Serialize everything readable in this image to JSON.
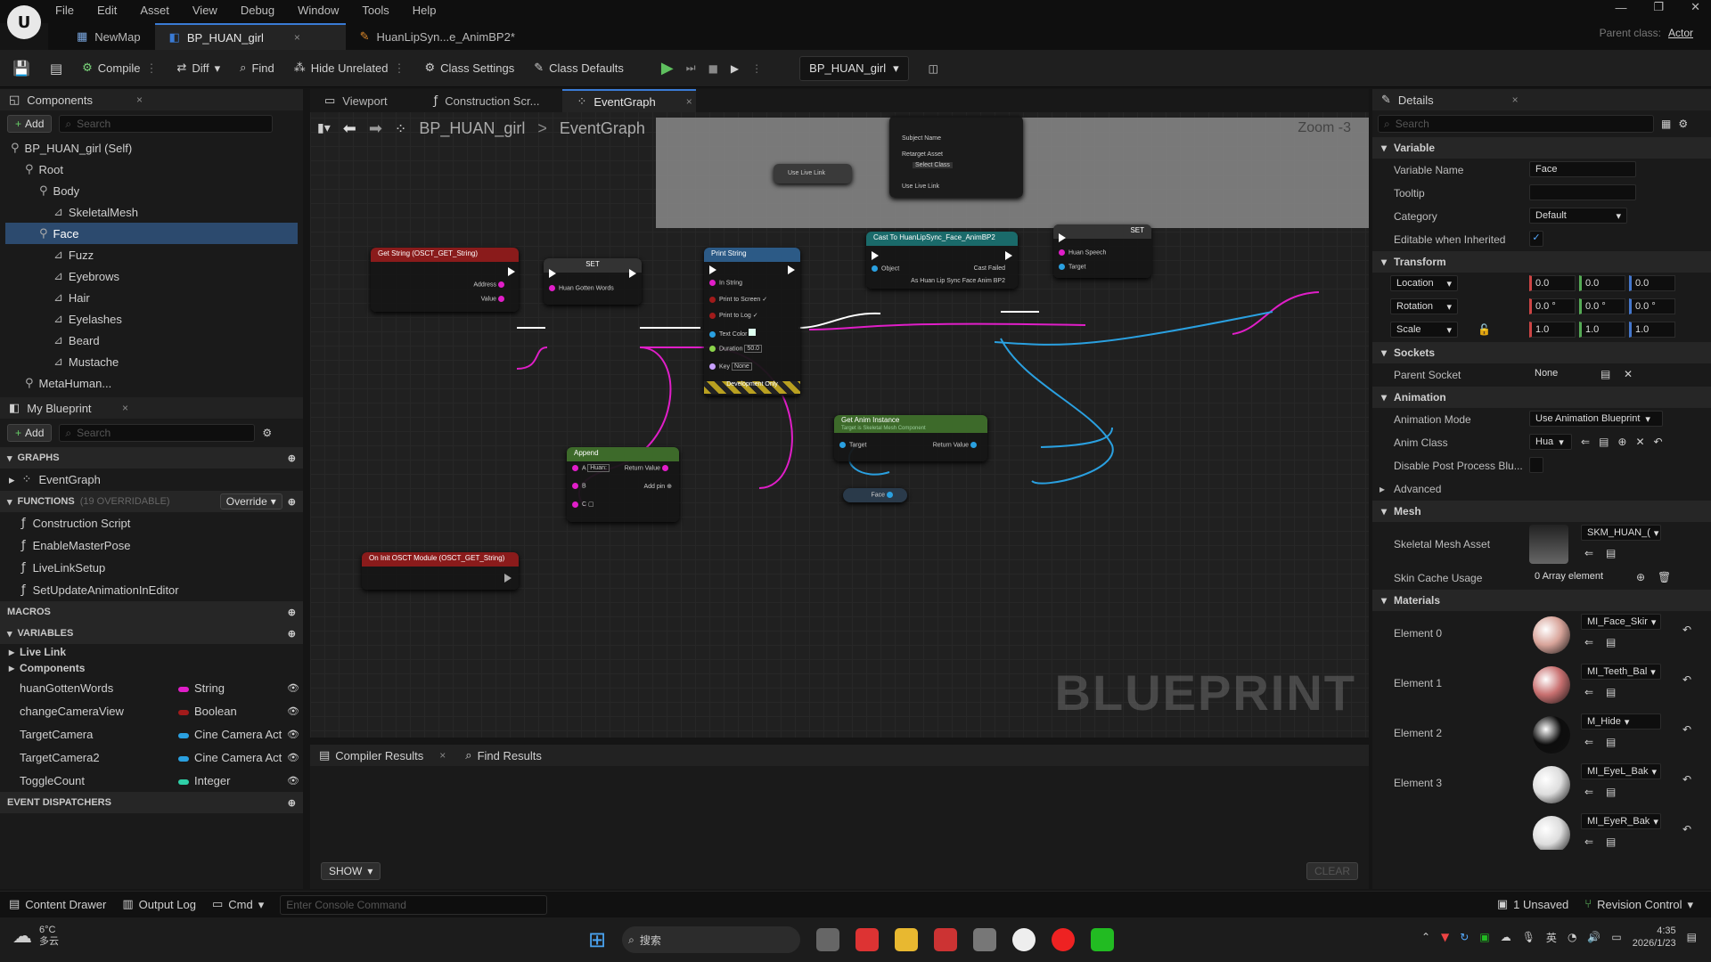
{
  "menu": [
    "File",
    "Edit",
    "Asset",
    "View",
    "Debug",
    "Window",
    "Tools",
    "Help"
  ],
  "doc_tabs": [
    {
      "label": "NewMap",
      "close": ""
    },
    {
      "label": "BP_HUAN_girl",
      "close": "×"
    },
    {
      "label": "HuanLipSyn...e_AnimBP2*",
      "close": ""
    }
  ],
  "parent_class": {
    "label": "Parent class:",
    "value": "Actor"
  },
  "toolbar": {
    "compile": "Compile",
    "diff": "Diff",
    "find": "Find",
    "hide_unrelated": "Hide Unrelated",
    "class_settings": "Class Settings",
    "class_defaults": "Class Defaults",
    "debug_target": "BP_HUAN_girl"
  },
  "components": {
    "title": "Components",
    "add": "Add",
    "search_placeholder": "Search",
    "tree": [
      {
        "label": "BP_HUAN_girl (Self)",
        "depth": 0
      },
      {
        "label": "Root",
        "depth": 1
      },
      {
        "label": "Body",
        "depth": 2
      },
      {
        "label": "SkeletalMesh",
        "depth": 3
      },
      {
        "label": "Face",
        "depth": 2,
        "selected": true
      },
      {
        "label": "Fuzz",
        "depth": 3
      },
      {
        "label": "Eyebrows",
        "depth": 3
      },
      {
        "label": "Hair",
        "depth": 3
      },
      {
        "label": "Eyelashes",
        "depth": 3
      },
      {
        "label": "Beard",
        "depth": 3
      },
      {
        "label": "Mustache",
        "depth": 3
      },
      {
        "label": "MetaHuman...",
        "depth": 1
      }
    ]
  },
  "my_blueprint": {
    "title": "My Blueprint",
    "add": "Add",
    "search_placeholder": "Search",
    "graphs_label": "GRAPHS",
    "event_graph": "EventGraph",
    "functions_label": "FUNCTIONS",
    "functions_count": "(19 OVERRIDABLE)",
    "override": "Override",
    "functions": [
      "Construction Script",
      "EnableMasterPose",
      "LiveLinkSetup",
      "SetUpdateAnimationInEditor"
    ],
    "macros_label": "MACROS",
    "variables_label": "VARIABLES",
    "live_link": "Live Link",
    "components_label": "Components",
    "variables": [
      {
        "name": "huanGottenWords",
        "type": "String",
        "color": "#e01ec8"
      },
      {
        "name": "changeCameraView",
        "type": "Boolean",
        "color": "#a11b1b"
      },
      {
        "name": "TargetCamera",
        "type": "Cine Camera Act",
        "color": "#2aa0e0"
      },
      {
        "name": "TargetCamera2",
        "type": "Cine Camera Act",
        "color": "#2aa0e0"
      },
      {
        "name": "ToggleCount",
        "type": "Integer",
        "color": "#2fd0a8"
      }
    ],
    "dispatchers_label": "EVENT DISPATCHERS"
  },
  "graph_tabs": [
    {
      "label": "Viewport"
    },
    {
      "label": "Construction Scr..."
    },
    {
      "label": "EventGraph",
      "close": "×"
    }
  ],
  "breadcrumb": {
    "bp": "BP_HUAN_girl",
    "sep": ">",
    "graph": "EventGraph",
    "zoom": "Zoom -3"
  },
  "nodes": {
    "use_live_link": "Use Live Link",
    "subject_name": "Subject Name",
    "retarget_asset": "Retarget Asset",
    "select_class": "Select Class",
    "use_live_link2": "Use Live Link",
    "get_string": "Get String (OSCT_GET_String)",
    "address": "Address",
    "value": "Value",
    "set": "SET",
    "huan_gotten_words": "Huan Gotten Words",
    "print_string": "Print String",
    "in_string": "In String",
    "print_to_screen": "Print to Screen",
    "print_to_log": "Print to Log",
    "text_color": "Text Color",
    "duration": "Duration",
    "duration_val": "50.0",
    "key": "Key",
    "key_val": "None",
    "dev_only": "Development Only",
    "cast": "Cast To HuanLipSync_Face_AnimBP2",
    "object": "Object",
    "cast_failed": "Cast Failed",
    "as_huan": "As Huan Lip Sync Face Anim BP2",
    "set2": "SET",
    "huan_speech": "Huan Speech",
    "target": "Target",
    "append": "Append",
    "a": "A",
    "a_val": "Huan:",
    "b": "B",
    "c": "C",
    "return_value": "Return Value",
    "add_pin": "Add pin",
    "get_anim": "Get Anim Instance",
    "get_anim_sub": "Target is Skeletal Mesh Component",
    "target2": "Target",
    "return_value2": "Return Value",
    "face": "Face",
    "on_init": "On Init OSCT Module (OSCT_GET_String)"
  },
  "watermark": "BLUEPRINT",
  "results_tabs": {
    "compiler": "Compiler Results",
    "find": "Find Results",
    "show": "SHOW",
    "clear": "CLEAR"
  },
  "details": {
    "title": "Details",
    "search_placeholder": "Search",
    "variable": {
      "section": "Variable",
      "name_label": "Variable Name",
      "name_val": "Face",
      "tooltip_label": "Tooltip",
      "category_label": "Category",
      "category_val": "Default",
      "editable_label": "Editable when Inherited"
    },
    "transform": {
      "section": "Transform",
      "location": "Location",
      "rotation": "Rotation",
      "scale": "Scale",
      "loc": [
        "0.0",
        "0.0",
        "0.0"
      ],
      "rot": [
        "0.0 °",
        "0.0 °",
        "0.0 °"
      ],
      "scl": [
        "1.0",
        "1.0",
        "1.0"
      ]
    },
    "sockets": {
      "section": "Sockets",
      "parent_socket": "Parent Socket",
      "parent_socket_val": "None"
    },
    "animation": {
      "section": "Animation",
      "mode_label": "Animation Mode",
      "mode_val": "Use Animation Blueprint",
      "class_label": "Anim Class",
      "class_val": "Hua",
      "disable_label": "Disable Post Process Blu...",
      "advanced": "Advanced"
    },
    "mesh": {
      "section": "Mesh",
      "asset_label": "Skeletal Mesh Asset",
      "asset_val": "SKM_HUAN_(",
      "skin_label": "Skin Cache Usage",
      "skin_val": "0 Array element"
    },
    "materials": {
      "section": "Materials",
      "items": [
        {
          "label": "Element 0",
          "val": "MI_Face_Skir",
          "color": "#d8a49a"
        },
        {
          "label": "Element 1",
          "val": "MI_Teeth_Bal",
          "color": "#c87070"
        },
        {
          "label": "Element 2",
          "val": "M_Hide",
          "color": "#0d0d0d"
        },
        {
          "label": "Element 3",
          "val": "MI_EyeL_Bak",
          "color": "#dddddd"
        },
        {
          "label": "",
          "val": "MI_EyeR_Bak",
          "color": "#dddddd"
        }
      ]
    }
  },
  "bottom": {
    "content_drawer": "Content Drawer",
    "output_log": "Output Log",
    "cmd": "Cmd",
    "console_placeholder": "Enter Console Command",
    "unsaved": "1 Unsaved",
    "revision": "Revision Control"
  },
  "taskbar": {
    "temp": "6°C",
    "weather": "多云",
    "search": "搜索",
    "ime": "英",
    "time": "4:35",
    "date": "2026/1/23"
  }
}
